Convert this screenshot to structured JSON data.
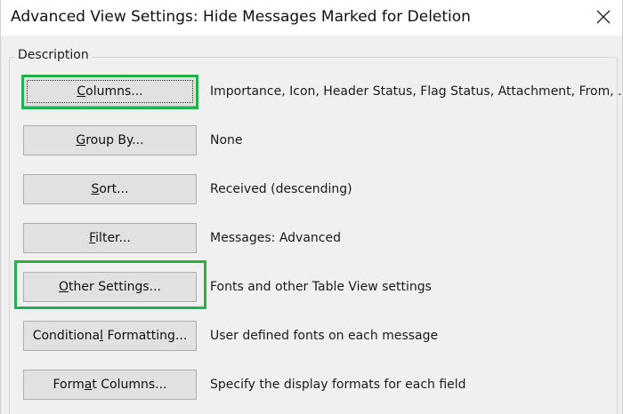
{
  "window": {
    "title": "Advanced View Settings: Hide Messages Marked for Deletion",
    "close_icon": "close-icon"
  },
  "group": {
    "label": "Description"
  },
  "rows": [
    {
      "pre": "",
      "key": "C",
      "post": "olumns...",
      "description": "Importance, Icon, Header Status, Flag Status, Attachment, From, ..."
    },
    {
      "pre": "",
      "key": "G",
      "post": "roup By...",
      "description": "None"
    },
    {
      "pre": "",
      "key": "S",
      "post": "ort...",
      "description": "Received (descending)"
    },
    {
      "pre": "",
      "key": "F",
      "post": "ilter...",
      "description": "Messages: Advanced"
    },
    {
      "pre": "",
      "key": "O",
      "post": "ther Settings...",
      "description": "Fonts and other Table View settings"
    },
    {
      "pre": "Conditiona",
      "key": "l",
      "post": " Formatting...",
      "description": "User defined fonts on each message"
    },
    {
      "pre": "Form",
      "key": "a",
      "post": "t Columns...",
      "description": "Specify the display formats for each field"
    }
  ],
  "colors": {
    "highlight": "#22b14c",
    "button_bg": "#e1e1e1",
    "dialog_bg": "#f0f0f0"
  }
}
